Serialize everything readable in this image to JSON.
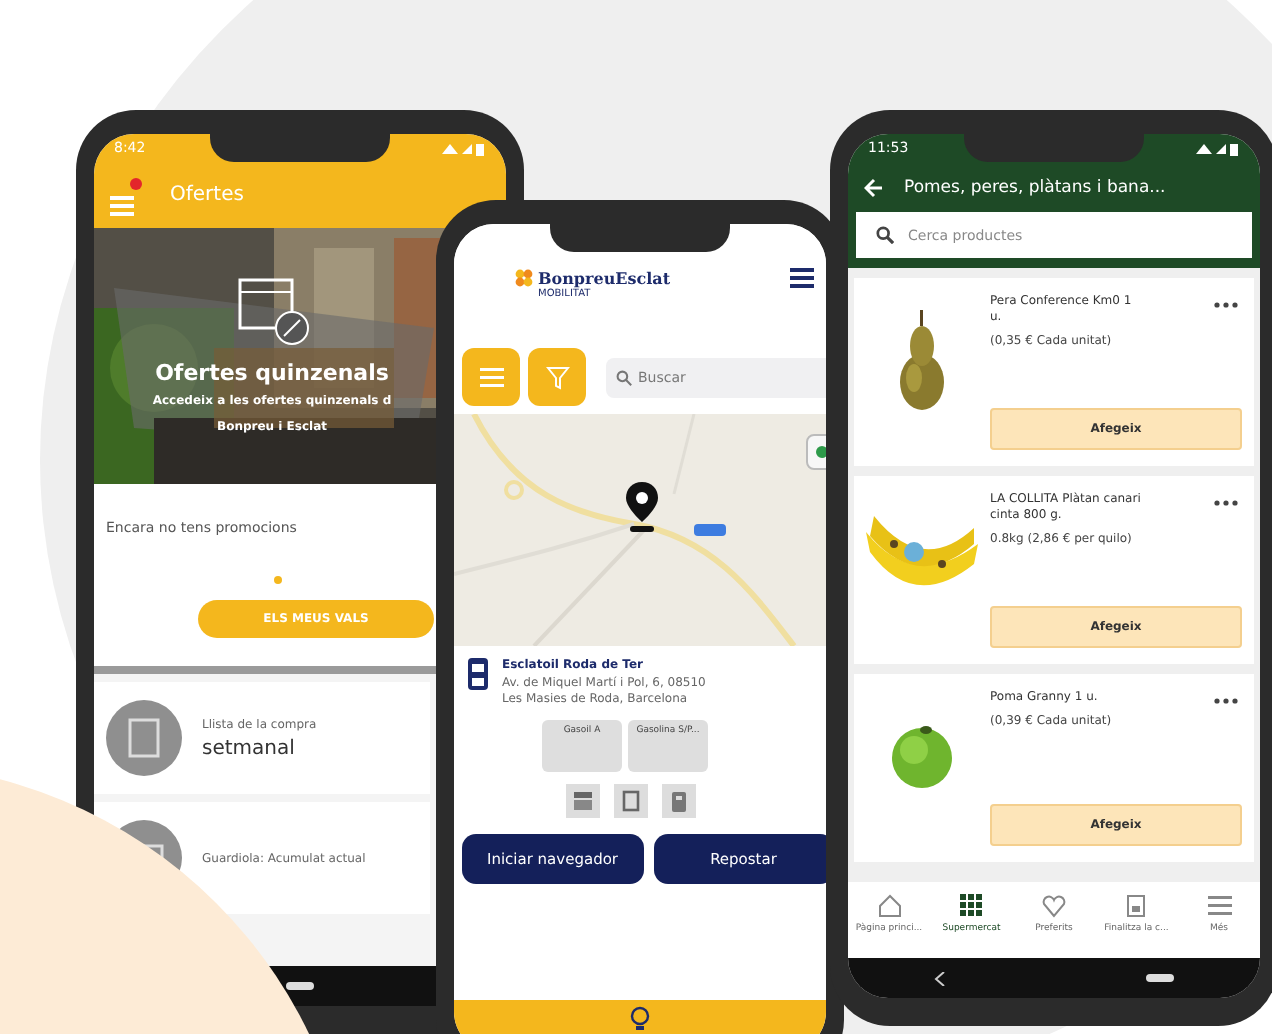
{
  "phones": [
    {
      "kind": "offers",
      "status_time": "8:42",
      "header": {
        "title": "Ofertes",
        "badge": true
      },
      "hero": {
        "title": "Ofertes quinzenals",
        "subtitle": "Accedeix a les ofertes quinzenals d",
        "caption": "Bonpreu i Esclat"
      },
      "empty_text": "Encara no tens promocions",
      "button": "ELS MEUS VALS",
      "cards": [
        {
          "label": "Llista de la compra",
          "value": "setmanal"
        },
        {
          "label": "Guardiola: Acumulat actual"
        }
      ]
    },
    {
      "kind": "stations",
      "logo": {
        "name": "BonpreuEsclat",
        "tagline": "MOBILITAT"
      },
      "search": {
        "placeholder": "Buscar"
      },
      "station": {
        "name": "Esclatoil Roda de Ter",
        "address": "Av. de Miquel Martí i Pol, 6, 08510 Les Masies de Roda, Barcelona",
        "fuels": [
          "Gasoil A",
          "Gasolina S/P..."
        ]
      },
      "buttons": [
        "Iniciar navegador",
        "Repostar"
      ]
    },
    {
      "kind": "products",
      "status_time": "11:53",
      "header": {
        "title": "Pomes, peres, plàtans i bana..."
      },
      "search": {
        "placeholder": "Cerca productes"
      },
      "products": [
        {
          "name": "Pera Conference Km0 1 u.",
          "price": "(0,35 € Cada unitat)",
          "button": "Afegeix"
        },
        {
          "name": "LA COLLITA Plàtan canari cinta 800 g.",
          "price": "0.8kg (2,86 € per quilo)",
          "button": "Afegeix"
        },
        {
          "name": "Poma Granny 1 u.",
          "price": "(0,39 € Cada unitat)",
          "button": "Afegeix"
        }
      ],
      "nav": [
        {
          "label": "Pàgina princi...",
          "selected": false
        },
        {
          "label": "Supermercat",
          "selected": true
        },
        {
          "label": "Preferits",
          "selected": false
        },
        {
          "label": "Finalitza la c...",
          "selected": false
        },
        {
          "label": "Més",
          "selected": false
        }
      ]
    }
  ]
}
